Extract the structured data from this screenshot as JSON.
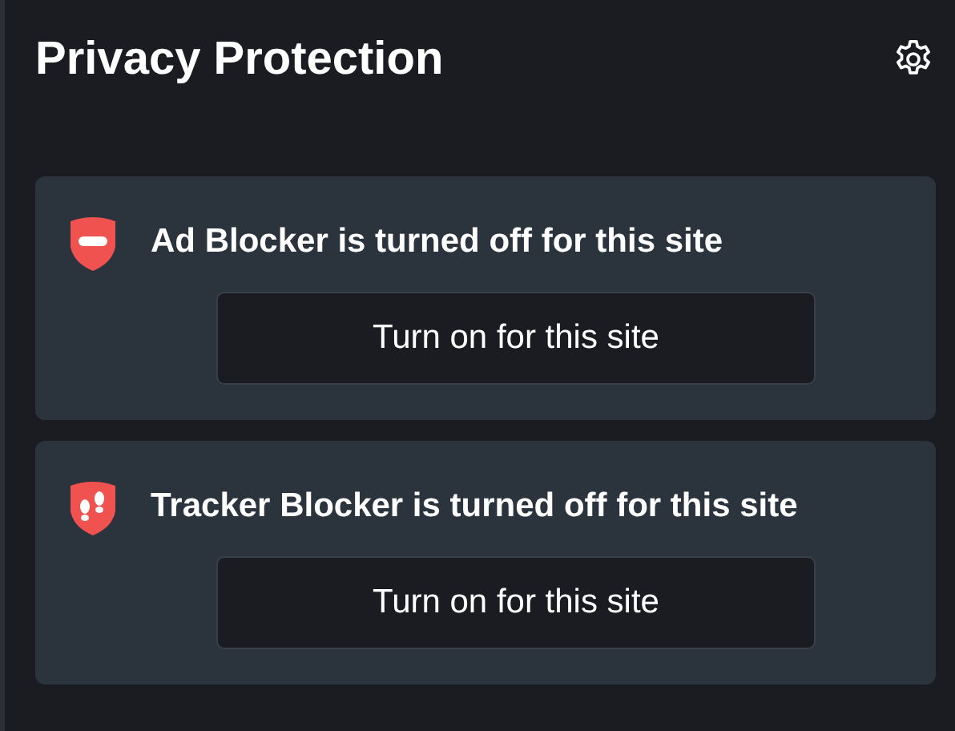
{
  "header": {
    "title": "Privacy Protection"
  },
  "cards": [
    {
      "kind": "ad",
      "message": "Ad Blocker is turned off for this site",
      "button": "Turn on for this site"
    },
    {
      "kind": "tracker",
      "message": "Tracker Blocker is turned off for this site",
      "button": "Turn on for this site"
    }
  ]
}
